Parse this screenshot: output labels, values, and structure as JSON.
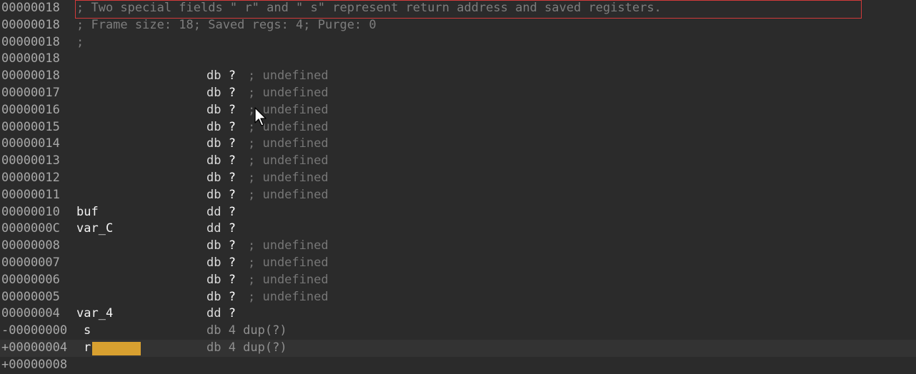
{
  "header_comments": [
    {
      "addr": "00000018",
      "text": "; Two special fields \" r\" and \" s\" represent return address and saved registers."
    },
    {
      "addr": "00000018",
      "text": "; Frame size: 18; Saved regs: 4; Purge: 0"
    },
    {
      "addr": "00000018",
      "text": ";"
    },
    {
      "addr": "00000018",
      "text": ""
    }
  ],
  "members": [
    {
      "addr": "00000018",
      "name": "",
      "directive": "db",
      "operand": "?",
      "comment": "; undefined"
    },
    {
      "addr": "00000017",
      "name": "",
      "directive": "db",
      "operand": "?",
      "comment": "; undefined"
    },
    {
      "addr": "00000016",
      "name": "",
      "directive": "db",
      "operand": "?",
      "comment": "; undefined"
    },
    {
      "addr": "00000015",
      "name": "",
      "directive": "db",
      "operand": "?",
      "comment": "; undefined"
    },
    {
      "addr": "00000014",
      "name": "",
      "directive": "db",
      "operand": "?",
      "comment": "; undefined"
    },
    {
      "addr": "00000013",
      "name": "",
      "directive": "db",
      "operand": "?",
      "comment": "; undefined"
    },
    {
      "addr": "00000012",
      "name": "",
      "directive": "db",
      "operand": "?",
      "comment": "; undefined"
    },
    {
      "addr": "00000011",
      "name": "",
      "directive": "db",
      "operand": "?",
      "comment": "; undefined"
    },
    {
      "addr": "00000010",
      "name": "buf",
      "directive": "dd",
      "operand": "?",
      "comment": ""
    },
    {
      "addr": "0000000C",
      "name": "var_C",
      "directive": "dd",
      "operand": "?",
      "comment": ""
    },
    {
      "addr": "00000008",
      "name": "",
      "directive": "db",
      "operand": "?",
      "comment": "; undefined"
    },
    {
      "addr": "00000007",
      "name": "",
      "directive": "db",
      "operand": "?",
      "comment": "; undefined"
    },
    {
      "addr": "00000006",
      "name": "",
      "directive": "db",
      "operand": "?",
      "comment": "; undefined"
    },
    {
      "addr": "00000005",
      "name": "",
      "directive": "db",
      "operand": "?",
      "comment": "; undefined"
    },
    {
      "addr": "00000004",
      "name": "var_4",
      "directive": "dd",
      "operand": "?",
      "comment": ""
    }
  ],
  "special_fields": [
    {
      "addr": "-00000000",
      "name": "s",
      "directive": "db 4 dup(?)",
      "selected": false
    },
    {
      "addr": "+00000004",
      "name": "r",
      "directive": "db 4 dup(?)",
      "selected": true
    }
  ],
  "trailing": {
    "addr": "+00000008"
  },
  "colors": {
    "background": "#2b2b2b",
    "address": "#a9a9a9",
    "name_highlight": "#d8a030",
    "focus_box": "#d23a3a",
    "comment": "#767676"
  },
  "cursor_icon": "mouse-pointer-icon"
}
